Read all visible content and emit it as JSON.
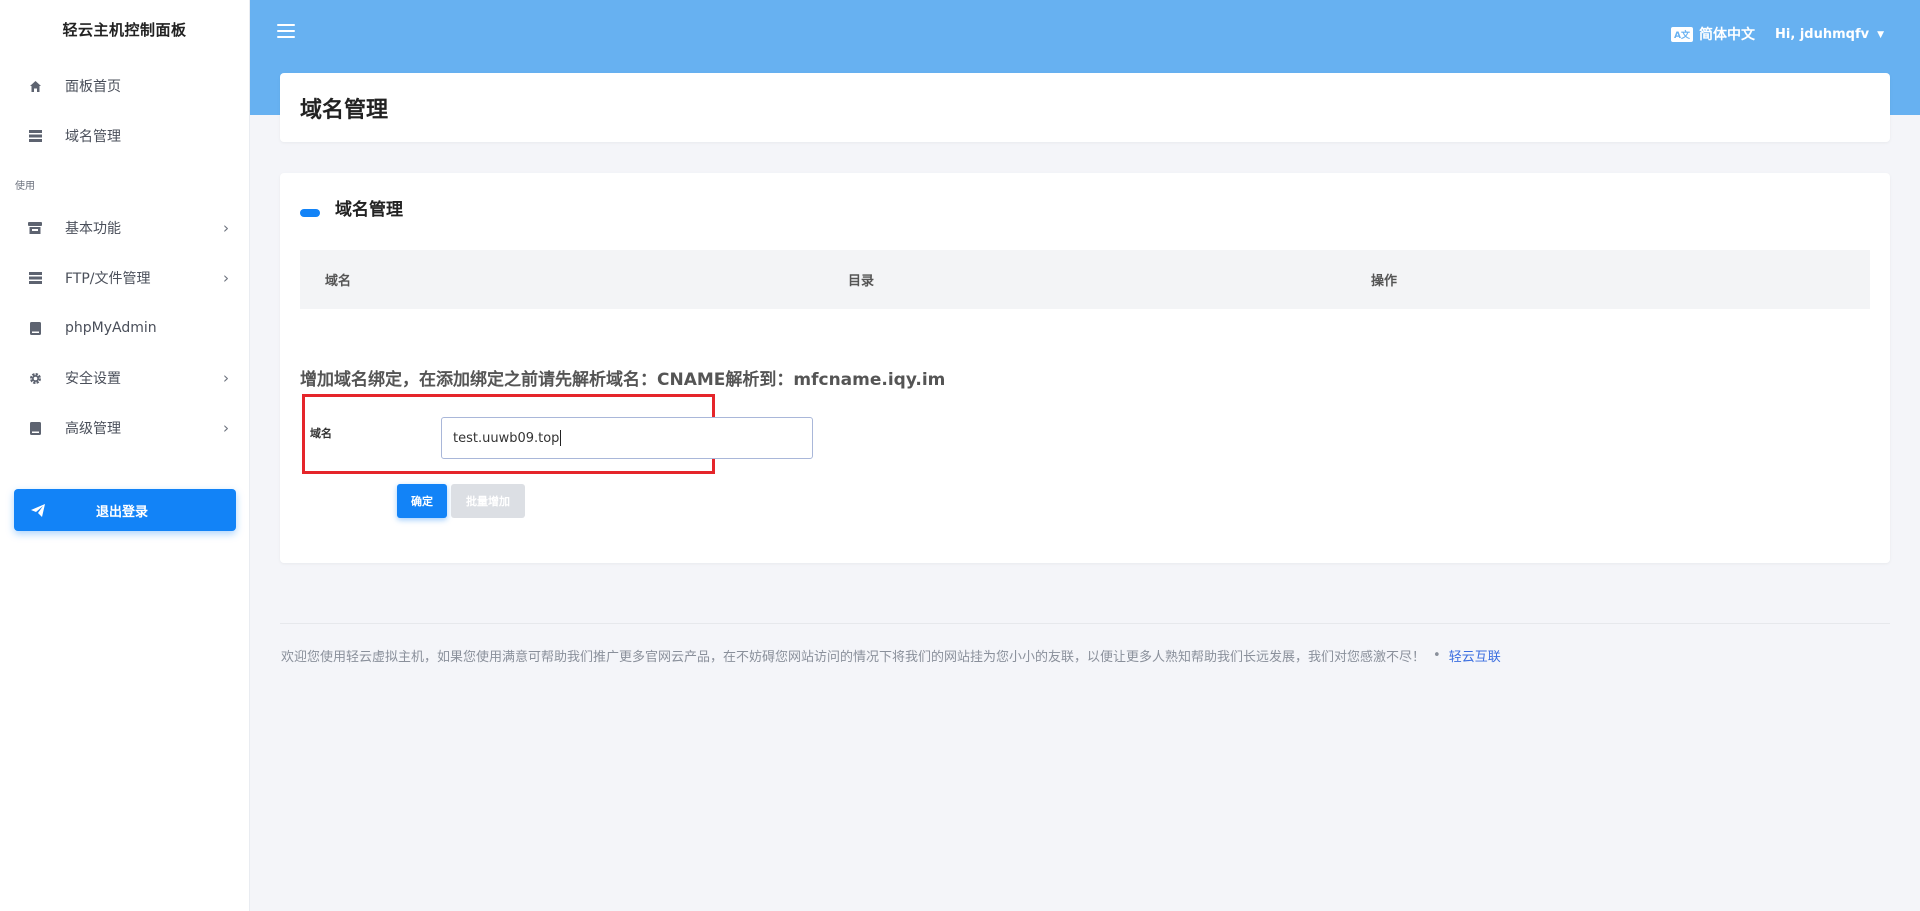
{
  "sidebar": {
    "brand": "轻云主机控制面板",
    "items_top": [
      {
        "label": "面板首页",
        "icon": "dashboard-icon"
      },
      {
        "label": "域名管理",
        "icon": "list-icon"
      }
    ],
    "section_label": "使用",
    "items_use": [
      {
        "label": "基本功能",
        "icon": "store-icon",
        "has_submenu": true
      },
      {
        "label": "FTP/文件管理",
        "icon": "server-icon",
        "has_submenu": true
      },
      {
        "label": "phpMyAdmin",
        "icon": "book-icon",
        "has_submenu": false
      },
      {
        "label": "安全设置",
        "icon": "gear-icon",
        "has_submenu": true
      },
      {
        "label": "高级管理",
        "icon": "book-icon",
        "has_submenu": true
      }
    ],
    "logout_label": "退出登录"
  },
  "topbar": {
    "language": "简体中文",
    "user_greeting": "Hi, jduhmqfv"
  },
  "page": {
    "title": "域名管理"
  },
  "card": {
    "title": "域名管理",
    "table": {
      "columns": [
        "域名",
        "目录",
        "操作"
      ],
      "rows": []
    },
    "info_text": "增加域名绑定，在添加绑定之前请先解析域名：CNAME解析到：mfcname.iqy.im",
    "form": {
      "field_label": "域名",
      "domain_value": "test.uuwb09.top",
      "confirm_label": "确定",
      "batch_label": "批量增加"
    }
  },
  "footer": {
    "text": "欢迎您使用轻云虚拟主机，如果您使用满意可帮助我们推广更多官网云产品，在不妨碍您网站访问的情况下将我们的网站挂为您小小的友联，以便让更多人熟知帮助我们长远发展，我们对您感激不尽！",
    "separator": "•",
    "link_text": "轻云互联"
  },
  "colors": {
    "primary": "#1283f7",
    "topbar": "#67b1f1",
    "highlight_border": "#e5252a"
  }
}
